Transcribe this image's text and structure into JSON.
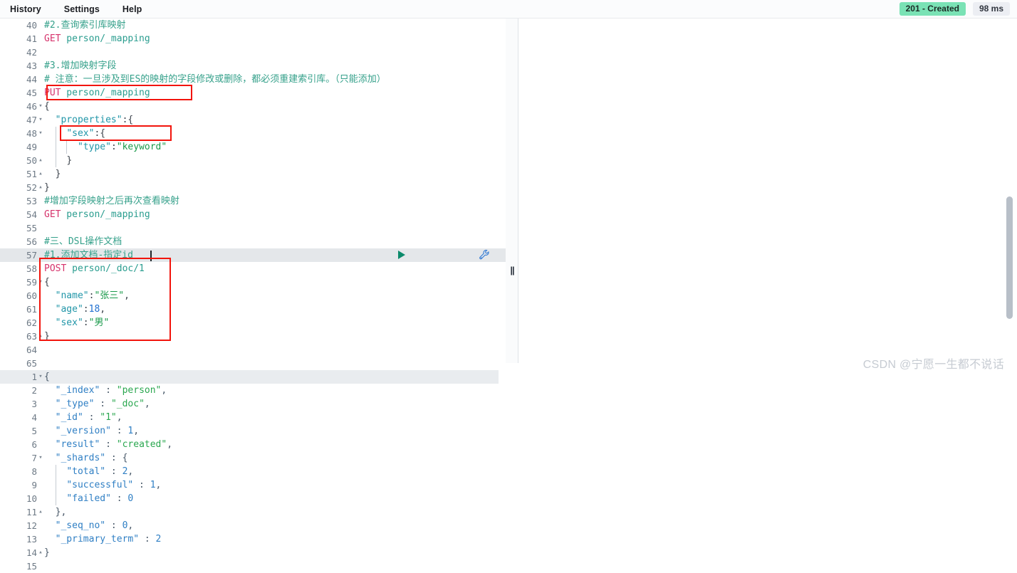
{
  "topbar": {
    "menu": [
      {
        "id": "history",
        "label": "History"
      },
      {
        "id": "settings",
        "label": "Settings"
      },
      {
        "id": "help",
        "label": "Help"
      }
    ],
    "status_badge": "201 - Created",
    "status_badge_color": "#7ae2b5",
    "timing_badge": "98 ms",
    "timing_badge_color": "#eceef3"
  },
  "editor": {
    "first_line_number": 40,
    "active_line_number": 57,
    "play_icon": "play-icon",
    "wrench_icon": "wrench-icon",
    "lines": [
      {
        "n": 40,
        "text": "#2.查询索引库映射"
      },
      {
        "n": 41,
        "text": "GET person/_mapping"
      },
      {
        "n": 42,
        "text": ""
      },
      {
        "n": 43,
        "text": "#3.增加映射字段"
      },
      {
        "n": 44,
        "text": "# 注意：一旦涉及到ES的映射的字段修改或删除，都必须重建索引库。（只能添加）"
      },
      {
        "n": 45,
        "text": "PUT person/_mapping"
      },
      {
        "n": 46,
        "text": "{"
      },
      {
        "n": 47,
        "text": "  \"properties\":{"
      },
      {
        "n": 48,
        "text": "    \"sex\":{"
      },
      {
        "n": 49,
        "text": "      \"type\":\"keyword\""
      },
      {
        "n": 50,
        "text": "    }"
      },
      {
        "n": 51,
        "text": "  }"
      },
      {
        "n": 52,
        "text": "}"
      },
      {
        "n": 53,
        "text": "#增加字段映射之后再次查看映射"
      },
      {
        "n": 54,
        "text": "GET person/_mapping"
      },
      {
        "n": 55,
        "text": ""
      },
      {
        "n": 56,
        "text": "#三、DSL操作文档"
      },
      {
        "n": 57,
        "text": "#1.添加文档-指定id"
      },
      {
        "n": 58,
        "text": "POST person/_doc/1"
      },
      {
        "n": 59,
        "text": "{"
      },
      {
        "n": 60,
        "text": "  \"name\":\"张三\","
      },
      {
        "n": 61,
        "text": "  \"age\":18,"
      },
      {
        "n": 62,
        "text": "  \"sex\":\"男\""
      },
      {
        "n": 63,
        "text": "}"
      },
      {
        "n": 64,
        "text": ""
      },
      {
        "n": 65,
        "text": ""
      }
    ],
    "tokens": {
      "l40_comment": "#2.查询索引库映射",
      "l41_method": "GET",
      "l41_url": " person/_mapping",
      "l43_comment": "#3.增加映射字段",
      "l44_comment": "# 注意：一旦涉及到ES的映射的字段修改或删除，都必须重建索引库。（只能添加）",
      "l45_method": "PUT",
      "l45_url": " person/_mapping",
      "l46_brace": "{",
      "l47_key": "\"properties\"",
      "l47_rest": ":{",
      "l48_key": "\"sex\"",
      "l48_rest": ":{",
      "l49_key": "\"type\"",
      "l49_colon": ":",
      "l49_val": "\"keyword\"",
      "l50_brace": "}",
      "l51_brace": "}",
      "l52_brace": "}",
      "l53_comment": "#增加字段映射之后再次查看映射",
      "l54_method": "GET",
      "l54_url": " person/_mapping",
      "l56_comment": "#三、DSL操作文档",
      "l57_comment": "#1.添加文档-指定id",
      "l58_method": "POST",
      "l58_url": " person/_doc/1",
      "l59_brace": "{",
      "l60_key": "\"name\"",
      "l60_colon": ":",
      "l60_val": "\"张三\"",
      "l60_comma": ",",
      "l61_key": "\"age\"",
      "l61_colon": ":",
      "l61_val": "18",
      "l61_comma": ",",
      "l62_key": "\"sex\"",
      "l62_colon": ":",
      "l62_val": "\"男\"",
      "l63_brace": "}"
    },
    "annotation_color": "#f2140c",
    "annotation_label": "post-document-request-highlight"
  },
  "response": {
    "first_line_number": 1,
    "lines": [
      {
        "n": 1,
        "text": "{"
      },
      {
        "n": 2,
        "text": "  \"_index\" : \"person\","
      },
      {
        "n": 3,
        "text": "  \"_type\" : \"_doc\","
      },
      {
        "n": 4,
        "text": "  \"_id\" : \"1\","
      },
      {
        "n": 5,
        "text": "  \"_version\" : 1,"
      },
      {
        "n": 6,
        "text": "  \"result\" : \"created\","
      },
      {
        "n": 7,
        "text": "  \"_shards\" : {"
      },
      {
        "n": 8,
        "text": "    \"total\" : 2,"
      },
      {
        "n": 9,
        "text": "    \"successful\" : 1,"
      },
      {
        "n": 10,
        "text": "    \"failed\" : 0"
      },
      {
        "n": 11,
        "text": "  },"
      },
      {
        "n": 12,
        "text": "  \"_seq_no\" : 0,"
      },
      {
        "n": 13,
        "text": "  \"_primary_term\" : 2"
      },
      {
        "n": 14,
        "text": "}"
      },
      {
        "n": 15,
        "text": ""
      }
    ],
    "tokens": {
      "l1_brace": "{",
      "l2_key": "\"_index\"",
      "l2_sep": " : ",
      "l2_val": "\"person\"",
      "l2_comma": ",",
      "l3_key": "\"_type\"",
      "l3_sep": " : ",
      "l3_val": "\"_doc\"",
      "l3_comma": ",",
      "l4_key": "\"_id\"",
      "l4_sep": " : ",
      "l4_val": "\"1\"",
      "l4_comma": ",",
      "l5_key": "\"_version\"",
      "l5_sep": " : ",
      "l5_val": "1",
      "l5_comma": ",",
      "l6_key": "\"result\"",
      "l6_sep": " : ",
      "l6_val": "\"created\"",
      "l6_comma": ",",
      "l7_key": "\"_shards\"",
      "l7_sep": " : ",
      "l7_val": "{",
      "l8_key": "\"total\"",
      "l8_sep": " : ",
      "l8_val": "2",
      "l8_comma": ",",
      "l9_key": "\"successful\"",
      "l9_sep": " : ",
      "l9_val": "1",
      "l9_comma": ",",
      "l10_key": "\"failed\"",
      "l10_sep": " : ",
      "l10_val": "0",
      "l11_brace": "},",
      "l12_key": "\"_seq_no\"",
      "l12_sep": " : ",
      "l12_val": "0",
      "l12_comma": ",",
      "l13_key": "\"_primary_term\"",
      "l13_sep": " : ",
      "l13_val": "2",
      "l14_brace": "}"
    },
    "annotations": [
      {
        "label": "result-created-highlight",
        "color": "#f2140c"
      },
      {
        "label": "shards-successful-highlight",
        "color": "#f2140c"
      }
    ]
  },
  "watermark": "CSDN @宁愿一生都不说话"
}
